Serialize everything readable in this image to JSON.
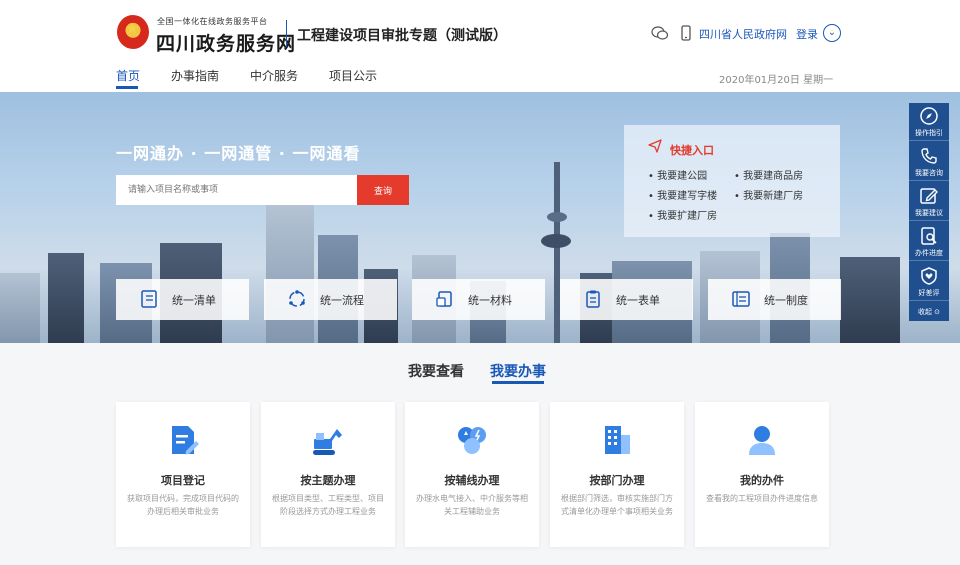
{
  "header": {
    "brand_small": "全国一体化在线政务服务平台",
    "brand_big": "四川政务服务网",
    "brand_sub": "工程建设项目审批专题（测试版）",
    "wechat_icon": "wechat-icon",
    "phone_icon": "mobile-phone-icon",
    "gov_link": "四川省人民政府网",
    "login": "登录",
    "expand_icon": "chevron-down-icon"
  },
  "nav": {
    "items": [
      "首页",
      "办事指南",
      "中介服务",
      "项目公示"
    ],
    "date": "2020年01月20日 星期一"
  },
  "hero": {
    "slogan": "一网通办 ·   一网通管   · 一网通看",
    "search": {
      "placeholder": "请输入项目名称或事项",
      "button": "查询"
    },
    "quick": {
      "title": "快捷入口",
      "links": [
        "我要建公园",
        "我要建商品房",
        "我要建写字楼",
        "我要新建厂房",
        "我要扩建厂房"
      ]
    },
    "unify": [
      {
        "label": "统一清单",
        "icon": "list-doc-icon"
      },
      {
        "label": "统一流程",
        "icon": "flow-cycle-icon"
      },
      {
        "label": "统一材料",
        "icon": "material-doc-icon"
      },
      {
        "label": "统一表单",
        "icon": "clipboard-form-icon"
      },
      {
        "label": "统一制度",
        "icon": "rules-list-icon"
      }
    ]
  },
  "side": {
    "items": [
      {
        "label": "操作指引",
        "icon": "compass-icon"
      },
      {
        "label": "我要咨询",
        "icon": "phone-icon"
      },
      {
        "label": "我要建议",
        "icon": "edit-icon"
      },
      {
        "label": "办件进度",
        "icon": "search-doc-icon"
      },
      {
        "label": "好差评",
        "icon": "shield-heart-icon"
      }
    ],
    "collapse": "收起"
  },
  "tabs": {
    "view": "我要查看",
    "do": "我要办事"
  },
  "cards": [
    {
      "title": "项目登记",
      "desc": "获取项目代码，完成项目代码的办理后相关审批业务",
      "icon": "doc-edit-icon"
    },
    {
      "title": "按主题办理",
      "desc": "根据项目类型、工程类型、项目阶段选择方式办理工程业务",
      "icon": "excavator-icon"
    },
    {
      "title": "按辅线办理",
      "desc": "办理水电气接入、中介服务等相关工程辅助业务",
      "icon": "water-electric-icon"
    },
    {
      "title": "按部门办理",
      "desc": "根据部门筛选，审核实施部门方式清单化办理单个事项相关业务",
      "icon": "building-icon"
    },
    {
      "title": "我的办件",
      "desc": "查看我的工程项目办件进度信息",
      "icon": "user-icon"
    }
  ],
  "colors": {
    "primary": "#1a58b8",
    "accent_red": "#e43b2c"
  }
}
